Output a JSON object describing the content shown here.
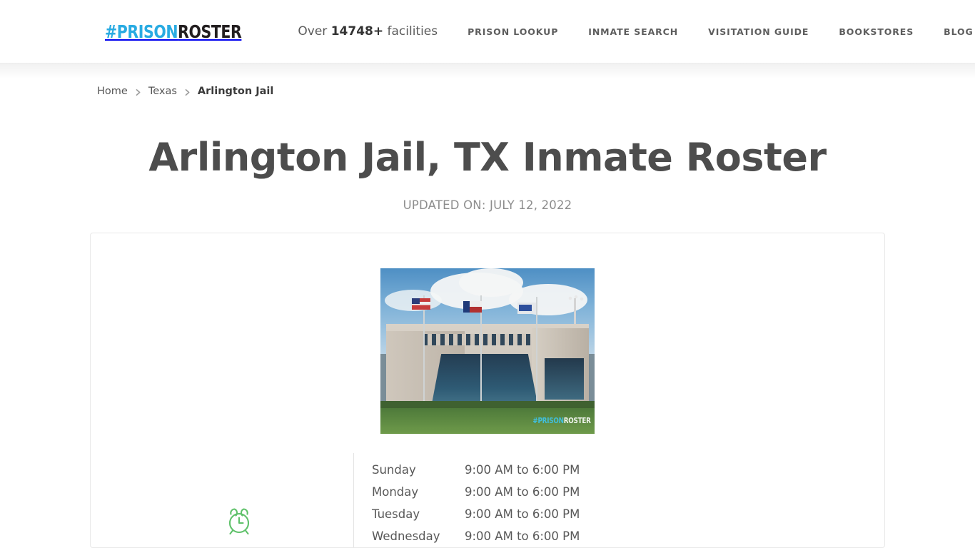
{
  "header": {
    "logo": {
      "part_a": "#PRISON",
      "part_b": "ROSTER",
      "color_a": "#29ABE2",
      "color_b": "#231f20"
    },
    "facility_count_prefix": "Over ",
    "facility_count_value": "14748+",
    "facility_count_suffix": " facilities",
    "nav": [
      {
        "label": "PRISON LOOKUP"
      },
      {
        "label": "INMATE SEARCH"
      },
      {
        "label": "VISITATION GUIDE"
      },
      {
        "label": "BOOKSTORES"
      },
      {
        "label": "BLOG"
      }
    ]
  },
  "breadcrumb": {
    "items": [
      {
        "label": "Home"
      },
      {
        "label": "Texas"
      },
      {
        "label": "Arlington Jail"
      }
    ]
  },
  "main": {
    "title": "Arlington Jail, TX Inmate Roster",
    "updated_on": "UPDATED ON: JULY 12, 2022",
    "photo_watermark_a": "#PRISON",
    "photo_watermark_b": "ROSTER",
    "clock_icon": "alarm-clock-icon",
    "clock_icon_color": "#5fc16a",
    "hours": {
      "rows": [
        {
          "day": "Sunday",
          "time": "9:00 AM to 6:00 PM"
        },
        {
          "day": "Monday",
          "time": "9:00 AM to 6:00 PM"
        },
        {
          "day": "Tuesday",
          "time": "9:00 AM to 6:00 PM"
        },
        {
          "day": "Wednesday",
          "time": "9:00 AM to 6:00 PM"
        }
      ]
    }
  }
}
